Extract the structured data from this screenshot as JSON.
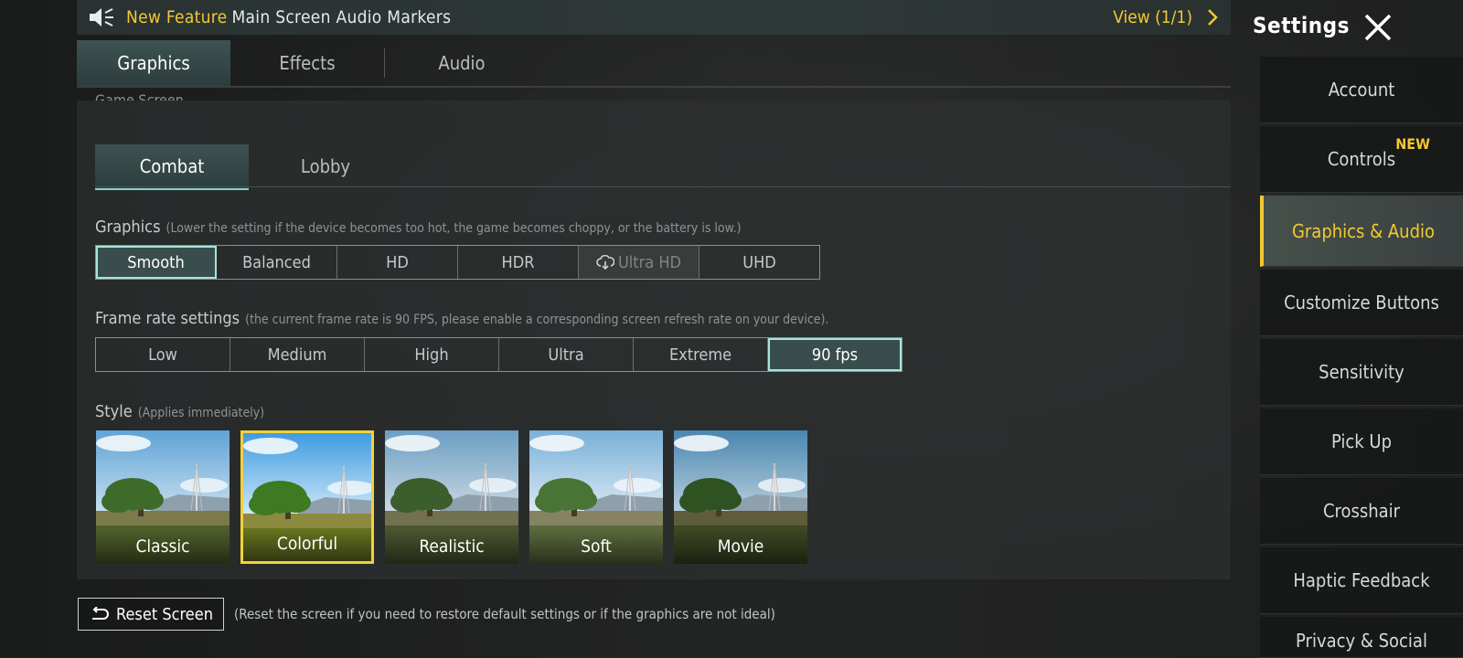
{
  "announcement": {
    "tag": "New Feature",
    "title": "Main Screen Audio Markers",
    "view": "View (1/1)"
  },
  "settings_title": "Settings",
  "tabs": [
    {
      "label": "Graphics",
      "active": true
    },
    {
      "label": "Effects",
      "active": false
    },
    {
      "label": "Audio",
      "active": false
    }
  ],
  "cut_label": "Game Screen",
  "subtabs": [
    {
      "label": "Combat",
      "active": true
    },
    {
      "label": "Lobby",
      "active": false
    }
  ],
  "graphics": {
    "label": "Graphics",
    "hint": "(Lower the setting if the device becomes too hot, the game becomes choppy, or the battery is low.)",
    "options": [
      "Smooth",
      "Balanced",
      "HD",
      "HDR",
      "Ultra HD",
      "UHD"
    ],
    "selected": "Smooth",
    "download_required": "Ultra HD"
  },
  "frame_rate": {
    "label": "Frame rate settings",
    "hint": "(the current frame rate is 90 FPS, please enable a corresponding screen refresh rate on your device).",
    "options": [
      "Low",
      "Medium",
      "High",
      "Ultra",
      "Extreme",
      "90 fps"
    ],
    "selected": "90 fps"
  },
  "style": {
    "label": "Style",
    "hint": "(Applies immediately)",
    "options": [
      "Classic",
      "Colorful",
      "Realistic",
      "Soft",
      "Movie"
    ],
    "selected": "Colorful"
  },
  "reset": {
    "label": "Reset Screen",
    "hint": "(Reset the screen if you need to restore default settings or if the graphics are not ideal)"
  },
  "sidebar": {
    "items": [
      {
        "label": "Account"
      },
      {
        "label": "Controls",
        "badge": "NEW"
      },
      {
        "label": "Graphics & Audio",
        "active": true
      },
      {
        "label": "Customize Buttons"
      },
      {
        "label": "Sensitivity"
      },
      {
        "label": "Pick Up"
      },
      {
        "label": "Crosshair"
      },
      {
        "label": "Haptic Feedback"
      },
      {
        "label": "Privacy & Social"
      }
    ]
  },
  "colors": {
    "accent_yellow": "#f2c933",
    "accent_teal": "#a6e4df",
    "panel": "#2e3030"
  },
  "icons": [
    "speaker-icon",
    "chevron-right-icon",
    "close-icon",
    "cloud-download-icon",
    "reset-icon"
  ]
}
